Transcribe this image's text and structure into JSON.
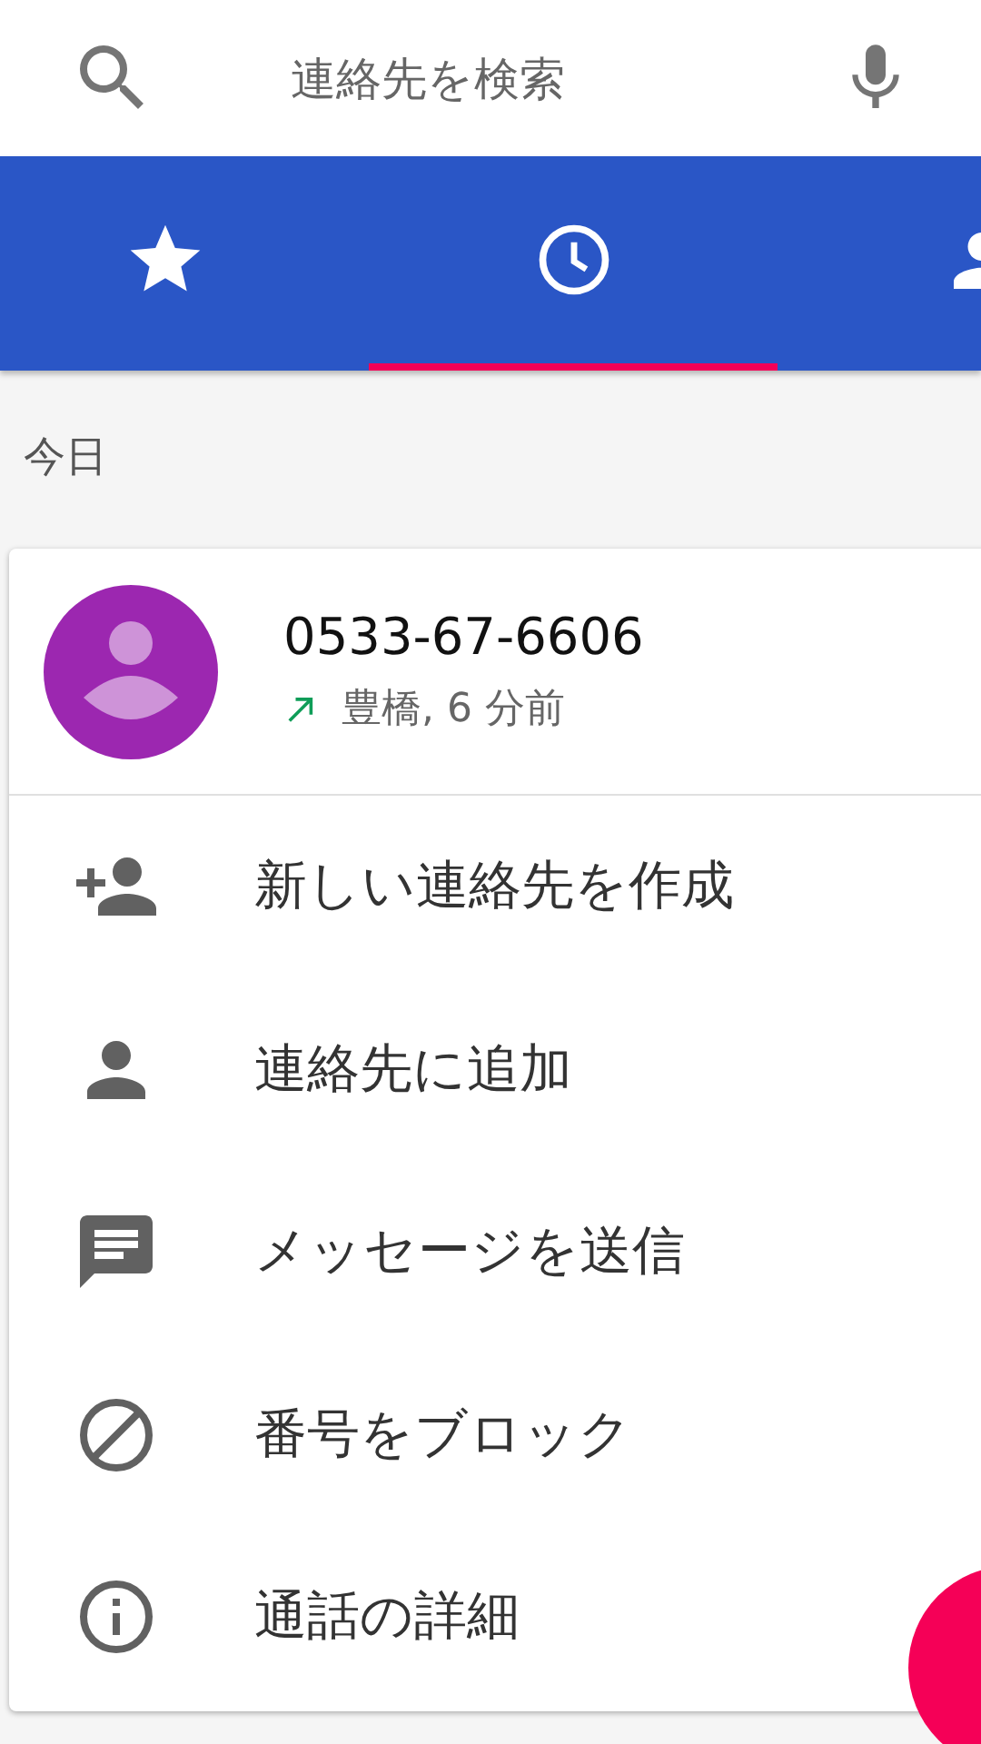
{
  "search": {
    "placeholder": "連絡先を検索"
  },
  "tabs": [
    {
      "kind": "favorites",
      "selected": false
    },
    {
      "kind": "recents",
      "selected": true
    },
    {
      "kind": "contacts",
      "selected": false
    }
  ],
  "section_header": "今日",
  "call": {
    "number": "0533-67-6606",
    "kind": "outgoing",
    "detail": "豊橋, 6 分前"
  },
  "actions": [
    {
      "kind": "add-contact",
      "label": "新しい連絡先を作成"
    },
    {
      "kind": "person",
      "label": "連絡先に追加"
    },
    {
      "kind": "message",
      "label": "メッセージを送信"
    },
    {
      "kind": "block",
      "label": "番号をブロック"
    },
    {
      "kind": "info",
      "label": "通話の詳細"
    }
  ]
}
